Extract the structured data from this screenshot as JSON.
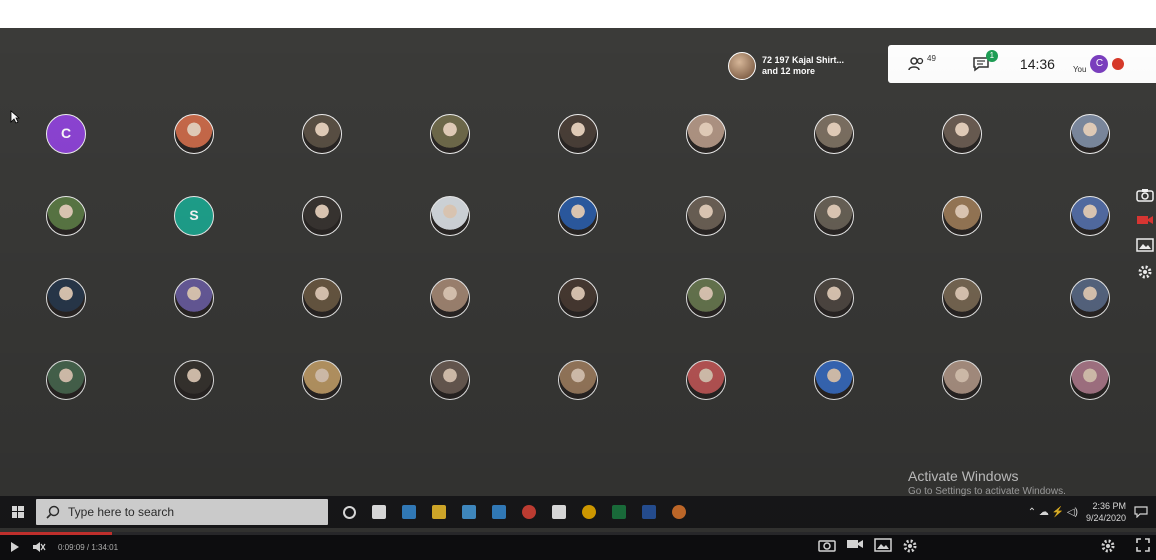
{
  "meeting": {
    "reaction_text_line1": "72 197 Kajal Shirt...",
    "reaction_text_line2": "and 12 more",
    "participants_count": "49",
    "chat_badge": "1",
    "clock": "14:36",
    "you_label": "You",
    "you_initial": "C"
  },
  "participants": [
    {
      "initial": "C",
      "color": "#8e44d6"
    },
    {
      "initial": "",
      "color": "#c96a4a"
    },
    {
      "initial": "",
      "color": "#5a5044"
    },
    {
      "initial": "",
      "color": "#6f6a4b"
    },
    {
      "initial": "",
      "color": "#4a3f38"
    },
    {
      "initial": "",
      "color": "#b09584"
    },
    {
      "initial": "",
      "color": "#7c7062"
    },
    {
      "initial": "",
      "color": "#6a5c52"
    },
    {
      "initial": "",
      "color": "#7d8aa0"
    },
    {
      "initial": "",
      "color": "#5c7a46"
    },
    {
      "initial": "S",
      "color": "#1fa58f"
    },
    {
      "initial": "",
      "color": "#3a3532"
    },
    {
      "initial": "",
      "color": "#d8dde2"
    },
    {
      "initial": "",
      "color": "#2d5da6"
    },
    {
      "initial": "",
      "color": "#6d6257"
    },
    {
      "initial": "",
      "color": "#6a6358"
    },
    {
      "initial": "",
      "color": "#9a7a58"
    },
    {
      "initial": "",
      "color": "#556fa8"
    },
    {
      "initial": "",
      "color": "#2a3a4e"
    },
    {
      "initial": "",
      "color": "#6b5ea0"
    },
    {
      "initial": "",
      "color": "#6b5a44"
    },
    {
      "initial": "",
      "color": "#a68a76"
    },
    {
      "initial": "",
      "color": "#4a3c34"
    },
    {
      "initial": "",
      "color": "#6a7a52"
    },
    {
      "initial": "",
      "color": "#514a44"
    },
    {
      "initial": "",
      "color": "#7a6a55"
    },
    {
      "initial": "",
      "color": "#5a6a86"
    },
    {
      "initial": "",
      "color": "#4b6a52"
    },
    {
      "initial": "",
      "color": "#3a3632"
    },
    {
      "initial": "",
      "color": "#c4a06a"
    },
    {
      "initial": "",
      "color": "#6e5f56"
    },
    {
      "initial": "",
      "color": "#a08062"
    },
    {
      "initial": "",
      "color": "#c45a5a"
    },
    {
      "initial": "",
      "color": "#3b6fc4"
    },
    {
      "initial": "",
      "color": "#b49a8a"
    },
    {
      "initial": "",
      "color": "#b07c8e"
    }
  ],
  "watermark": {
    "title": "Activate Windows",
    "subtitle": "Go to Settings to activate Windows."
  },
  "taskbar": {
    "search_placeholder": "Type here to search",
    "time": "2:36 PM",
    "date": "9/24/2020",
    "apps": [
      "cortana-icon",
      "task-view-icon",
      "edge-icon",
      "file-explorer-icon",
      "store-icon",
      "mail-icon",
      "opera-icon",
      "notepad-icon",
      "chrome-icon",
      "excel-icon",
      "word-icon",
      "paint-icon"
    ]
  },
  "player": {
    "time": "0:09:09 / 1:34:01",
    "progress_fraction": 0.097
  },
  "colors": {
    "screen_bg": "#3b3b39",
    "taskbar_bg": "#1a1a1c",
    "accent_red": "#e53935"
  }
}
